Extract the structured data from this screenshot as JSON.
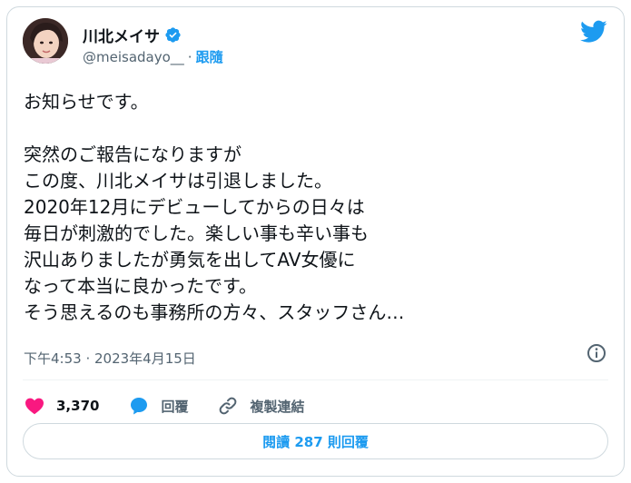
{
  "author": {
    "display_name": "川北メイサ",
    "handle": "@meisadayo__",
    "separator": "·",
    "follow_label": "跟隨"
  },
  "tweet": {
    "lines": [
      "お知らせです。",
      "",
      "突然のご報告になりますが",
      "この度、川北メイサは引退しました。",
      "2020年12月にデビューしてからの日々は",
      "毎日が刺激的でした。楽しい事も辛い事も",
      "沢山ありましたが勇気を出してAV女優に",
      "なって本当に良かったです。",
      "そう思えるのも事務所の方々、スタッフさん…"
    ],
    "timestamp": "下午4:53 · 2023年4月15日"
  },
  "actions": {
    "like_count": "3,370",
    "reply_label": "回覆",
    "copy_link_label": "複製連結"
  },
  "footer": {
    "read_replies_label": "閱讀 287 則回覆"
  },
  "colors": {
    "accent": "#1d9bf0",
    "like": "#f91880",
    "text": "#0f1419",
    "secondary": "#536471"
  }
}
